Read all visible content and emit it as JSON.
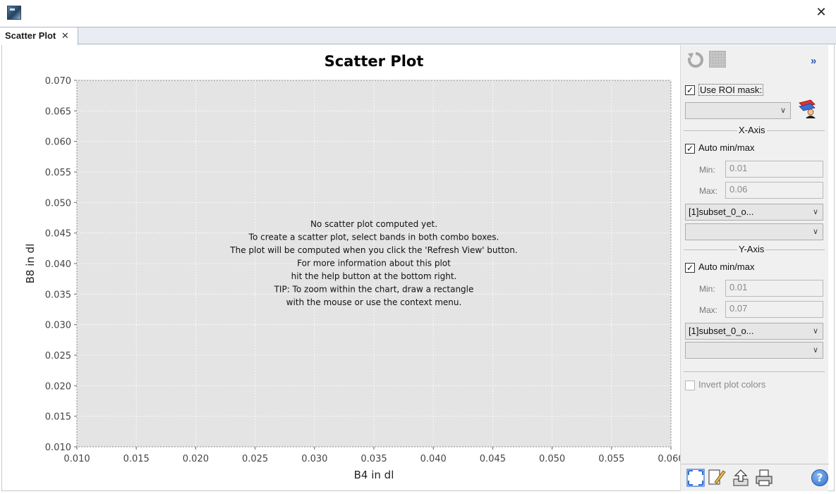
{
  "window": {
    "close_glyph": "✕"
  },
  "tabs": [
    {
      "label": "Scatter Plot",
      "close_glyph": "✕"
    }
  ],
  "chart_data": {
    "type": "scatter",
    "title": "Scatter Plot",
    "xlabel": "B4 in dl",
    "ylabel": "B8 in dl",
    "xlim": [
      0.01,
      0.06
    ],
    "ylim": [
      0.01,
      0.07
    ],
    "x_ticks": [
      "0.010",
      "0.015",
      "0.020",
      "0.025",
      "0.030",
      "0.035",
      "0.040",
      "0.045",
      "0.050",
      "0.055",
      "0.060"
    ],
    "y_ticks": [
      "0.070",
      "0.065",
      "0.060",
      "0.055",
      "0.050",
      "0.045",
      "0.040",
      "0.035",
      "0.030",
      "0.025",
      "0.020",
      "0.015",
      "0.010"
    ],
    "series": [],
    "grid": true,
    "plot_background": "#e4e4e4",
    "message_lines": [
      "No scatter plot computed yet.",
      "To create a scatter plot, select bands in both combo boxes.",
      "The plot will be computed when you click the 'Refresh View' button.",
      "For more information about this plot",
      "hit the help button at the bottom right.",
      "TIP: To zoom within the chart, draw a rectangle",
      "with the mouse or use the context menu."
    ]
  },
  "side": {
    "top_icons": [
      "refresh-icon",
      "grid-icon"
    ],
    "collapse_glyph": "»",
    "roi": {
      "label": "Use ROI mask:",
      "checked": true,
      "mask_value": "",
      "mask_icon": "roi-mask-manager-icon"
    },
    "x_axis": {
      "title": "X-Axis",
      "auto_label": "Auto min/max",
      "auto_checked": true,
      "min_label": "Min:",
      "min_value": "0.01",
      "max_label": "Max:",
      "max_value": "0.06",
      "band_value": "[1]subset_0_o...",
      "band2_value": ""
    },
    "y_axis": {
      "title": "Y-Axis",
      "auto_label": "Auto min/max",
      "auto_checked": true,
      "min_label": "Min:",
      "min_value": "0.01",
      "max_label": "Max:",
      "max_value": "0.07",
      "band_value": "[1]subset_0_o...",
      "band2_value": ""
    },
    "invert": {
      "label": "Invert plot colors",
      "checked": false,
      "enabled": false
    },
    "check_glyph": "✓",
    "dropdown_glyph": "∨",
    "bottom_icons": [
      "zoom-all-icon",
      "edit-icon",
      "export-icon",
      "print-icon",
      "help-icon"
    ],
    "help_glyph": "?"
  }
}
